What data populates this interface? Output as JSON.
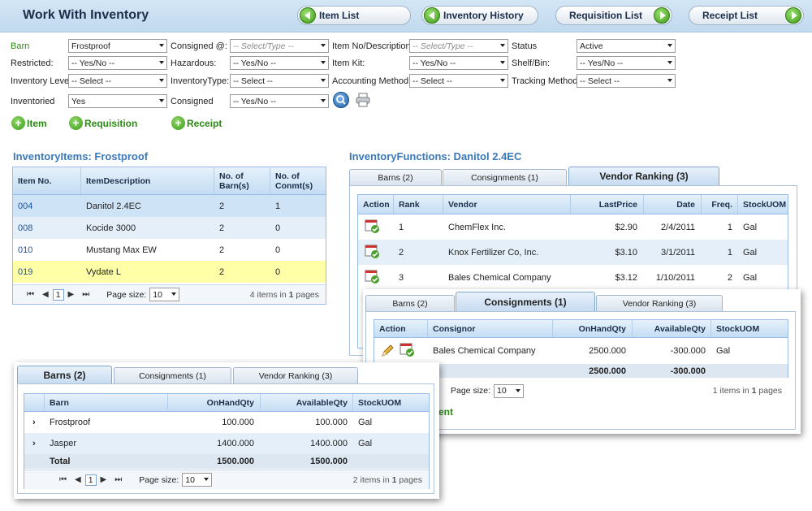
{
  "header": {
    "title": "Work With Inventory",
    "nav": [
      {
        "label": "Item List"
      },
      {
        "label": "Inventory History"
      },
      {
        "label": "Requisition List"
      },
      {
        "label": "Receipt List"
      }
    ]
  },
  "filters": {
    "barn": {
      "label": "Barn",
      "value": "Frostproof"
    },
    "consigned_at": {
      "label": "Consigned @:",
      "placeholder": "-- Select/Type --"
    },
    "item_no": {
      "label": "Item No/Description:",
      "placeholder": "-- Select/Type --"
    },
    "status": {
      "label": "Status",
      "value": "Active"
    },
    "restricted": {
      "label": "Restricted:",
      "value": "-- Yes/No --"
    },
    "hazardous": {
      "label": "Hazardous:",
      "value": "-- Yes/No --"
    },
    "item_kit": {
      "label": "Item Kit:",
      "value": "-- Yes/No --"
    },
    "shelf_bin": {
      "label": "Shelf/Bin:",
      "value": "-- Yes/No --"
    },
    "inventory_level": {
      "label": "Inventory Level:",
      "value": "-- Select --"
    },
    "inventory_type": {
      "label": "InventoryType:",
      "value": "-- Select --"
    },
    "accounting_method": {
      "label": "Accounting Method:",
      "value": "-- Select --"
    },
    "tracking_method": {
      "label": "Tracking Method:",
      "value": "-- Select --"
    },
    "inventoried": {
      "label": "Inventoried",
      "value": "Yes"
    },
    "consigned": {
      "label": "Consigned",
      "value": "-- Yes/No --"
    }
  },
  "actions": {
    "item": "Item",
    "requisition": "Requisition",
    "receipt": "Receipt"
  },
  "inventory": {
    "title": "InventoryItems: Frostproof",
    "columns": [
      "Item No.",
      "ItemDescription",
      "No. of Barn(s)",
      "No. of Conmt(s)"
    ],
    "rows": [
      {
        "no": "004",
        "desc": "Danitol 2.4EC",
        "barns": "2",
        "conmts": "1"
      },
      {
        "no": "008",
        "desc": "Kocide 3000",
        "barns": "2",
        "conmts": "0"
      },
      {
        "no": "010",
        "desc": "Mustang Max EW",
        "barns": "2",
        "conmts": "0"
      },
      {
        "no": "019",
        "desc": "Vydate L",
        "barns": "2",
        "conmts": "0"
      }
    ],
    "pager": {
      "page": "1",
      "size_label": "Page size:",
      "size": "10",
      "summary_count": "4",
      "summary_pages": "1",
      "items_word": "items in",
      "pages_word": "pages"
    }
  },
  "functions": {
    "title": "InventoryFunctions: Danitol 2.4EC"
  },
  "vendor_panel": {
    "tabs": [
      "Barns (2)",
      "Consignments (1)",
      "Vendor Ranking (3)"
    ],
    "columns": [
      "Action",
      "Rank",
      "Vendor",
      "LastPrice",
      "Date",
      "Freq.",
      "StockUOM"
    ],
    "rows": [
      {
        "rank": "1",
        "vendor": "ChemFlex Inc.",
        "price": "$2.90",
        "date": "2/4/2011",
        "freq": "1",
        "uom": "Gal"
      },
      {
        "rank": "2",
        "vendor": "Knox Fertilizer Co, Inc.",
        "price": "$3.10",
        "date": "3/1/2011",
        "freq": "1",
        "uom": "Gal"
      },
      {
        "rank": "3",
        "vendor": "Bales Chemical Company",
        "price": "$3.12",
        "date": "1/10/2011",
        "freq": "2",
        "uom": "Gal"
      }
    ]
  },
  "consign_panel": {
    "tabs": [
      "Barns (2)",
      "Consignments (1)",
      "Vendor Ranking (3)"
    ],
    "columns": [
      "Action",
      "Consignor",
      "OnHandQty",
      "AvailableQty",
      "StockUOM"
    ],
    "rows": [
      {
        "consignor": "Bales Chemical Company",
        "onhand": "2500.000",
        "avail": "-300.000",
        "uom": "Gal"
      }
    ],
    "totals": {
      "onhand": "2500.000",
      "avail": "-300.000"
    },
    "pager": {
      "size_label": "Page size:",
      "size": "10",
      "summary_count": "1",
      "summary_pages": "1",
      "items_word": "items in",
      "pages_word": "pages"
    },
    "partial_label": "ent"
  },
  "barns_panel": {
    "tabs": [
      "Barns (2)",
      "Consignments (1)",
      "Vendor Ranking (3)"
    ],
    "columns": [
      "Barn",
      "OnHandQty",
      "AvailableQty",
      "StockUOM"
    ],
    "rows": [
      {
        "barn": "Frostproof",
        "onhand": "100.000",
        "avail": "100.000",
        "uom": "Gal"
      },
      {
        "barn": "Jasper",
        "onhand": "1400.000",
        "avail": "1400.000",
        "uom": "Gal"
      }
    ],
    "totals": {
      "label": "Total",
      "onhand": "1500.000",
      "avail": "1500.000"
    },
    "pager": {
      "page": "1",
      "size_label": "Page size:",
      "size": "10",
      "summary_count": "2",
      "summary_pages": "1",
      "items_word": "items in",
      "pages_word": "pages"
    }
  },
  "colors": {
    "accent": "#3a78b8",
    "green": "#2a8a12",
    "highlight": "#ffffa8"
  }
}
